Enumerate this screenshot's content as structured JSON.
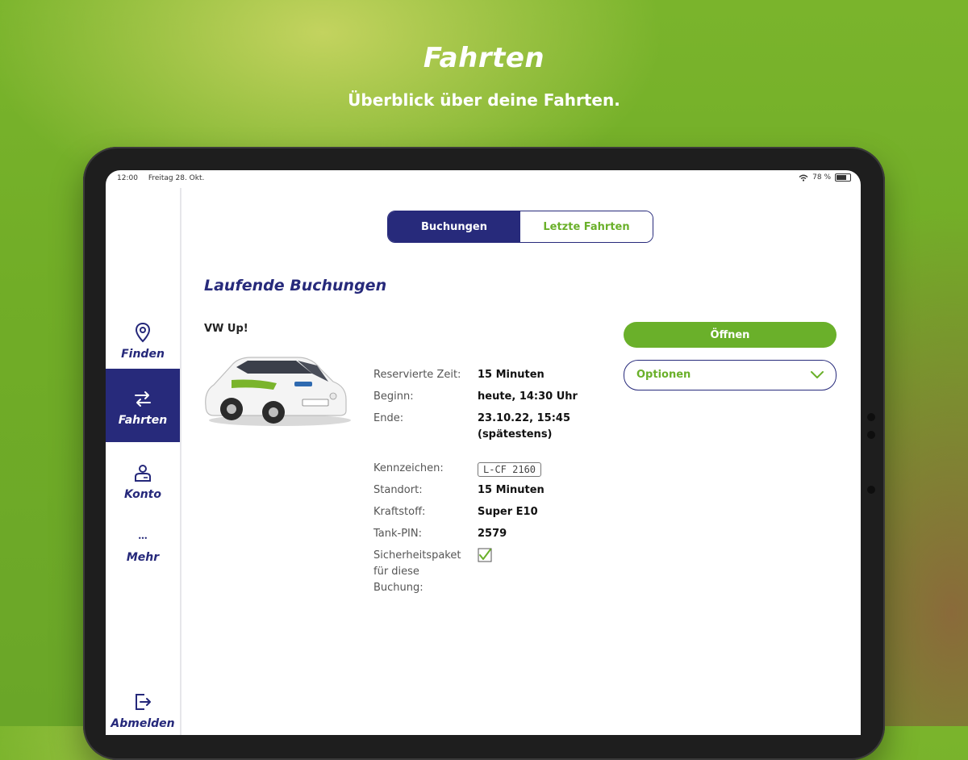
{
  "promo": {
    "title": "Fahrten",
    "subtitle": "Überblick über deine Fahrten."
  },
  "status_bar": {
    "time": "12:00",
    "date": "Freitag 28. Okt.",
    "battery": "78 %"
  },
  "sidebar": {
    "items": [
      {
        "label": "Finden",
        "icon": "location-pin-icon",
        "active": false
      },
      {
        "label": "Fahrten",
        "icon": "swap-arrows-icon",
        "active": true
      },
      {
        "label": "Konto",
        "icon": "user-card-icon",
        "active": false
      },
      {
        "label": "Mehr",
        "icon": "more-dots-icon",
        "active": false
      },
      {
        "label": "Abmelden",
        "icon": "logout-icon",
        "active": false
      }
    ]
  },
  "tabs": {
    "bookings": "Buchungen",
    "recent": "Letzte Fahrten"
  },
  "section": {
    "title": "Laufende Buchungen"
  },
  "booking": {
    "car_name": "VW Up!",
    "fields": {
      "reserved_label": "Reservierte Zeit:",
      "reserved_value": "15 Minuten",
      "start_label": "Beginn:",
      "start_value": "heute, 14:30 Uhr",
      "end_label": "Ende:",
      "end_value": "23.10.22, 15:45 (spätestens)",
      "plate_label": "Kennzeichen:",
      "plate_value": "L-CF 2160",
      "location_label": "Standort:",
      "location_value": "15 Minuten",
      "fuel_label": "Kraftstoff:",
      "fuel_value": "Super E10",
      "pin_label": "Tank-PIN:",
      "pin_value": "2579",
      "safety_label": "Sicherheitspaket für diese Buchung:",
      "safety_checked": true
    },
    "open_button": "Öffnen",
    "options_button": "Optionen"
  },
  "colors": {
    "brand_navy": "#272a7b",
    "brand_green": "#6ab02a",
    "background_green": "#74af28"
  }
}
